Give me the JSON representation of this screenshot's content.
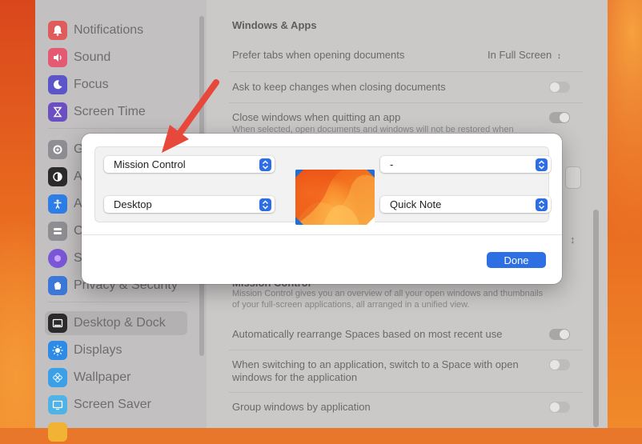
{
  "sidebar": {
    "items": [
      {
        "label": "Notifications",
        "icon": "bell-icon",
        "color": "#e05b5b"
      },
      {
        "label": "Sound",
        "icon": "speaker-icon",
        "color": "#e45a72"
      },
      {
        "label": "Focus",
        "icon": "moon-icon",
        "color": "#5b55c9"
      },
      {
        "label": "Screen Time",
        "icon": "hourglass-icon",
        "color": "#6b4fc1"
      },
      {
        "label": "G",
        "icon": "gear-icon",
        "color": "#8e8e93"
      },
      {
        "label": "A",
        "icon": "appearance-icon",
        "color": "#2b2b2b"
      },
      {
        "label": "A",
        "icon": "accessibility-icon",
        "color": "#2d7fe6"
      },
      {
        "label": "C",
        "icon": "control-center-icon",
        "color": "#8e8e93"
      },
      {
        "label": "S",
        "icon": "siri-icon",
        "color": "#7a57d6"
      },
      {
        "label": "Privacy & Security",
        "icon": "hand-icon",
        "color": "#3b78d8"
      },
      {
        "label": "Desktop & Dock",
        "icon": "dock-icon",
        "color": "#2b2b2b"
      },
      {
        "label": "Displays",
        "icon": "sun-icon",
        "color": "#2d8ae6"
      },
      {
        "label": "Wallpaper",
        "icon": "flower-icon",
        "color": "#3aa0e8"
      },
      {
        "label": "Screen Saver",
        "icon": "screensaver-icon",
        "color": "#4fb3e6"
      }
    ]
  },
  "content": {
    "section_title": "Windows & Apps",
    "rows": {
      "prefer_tabs": {
        "label": "Prefer tabs when opening documents",
        "value": "In Full Screen"
      },
      "ask_keep": {
        "label": "Ask to keep changes when closing documents"
      },
      "close_windows": {
        "label": "Close windows when quitting an app",
        "sub": "When selected, open documents and windows will not be restored when"
      },
      "mission_title": "Mission Control",
      "mission_desc_1": "Mission Control gives you an overview of all your open windows and thumbnails",
      "mission_desc_2": "of your full-screen applications, all arranged in a unified view.",
      "auto_rearrange": {
        "label": "Automatically rearrange Spaces based on most recent use"
      },
      "switch_space": {
        "label_1": "When switching to an application, switch to a Space with open",
        "label_2": "windows for the application"
      },
      "group_windows": {
        "label": "Group windows by application"
      }
    }
  },
  "hot_corners": {
    "top_left": "Mission Control",
    "top_right": "-",
    "bottom_left": "Desktop",
    "bottom_right": "Quick Note",
    "done_label": "Done"
  },
  "colors": {
    "accent": "#2f6fe4",
    "annotation_arrow": "#e8483b"
  }
}
